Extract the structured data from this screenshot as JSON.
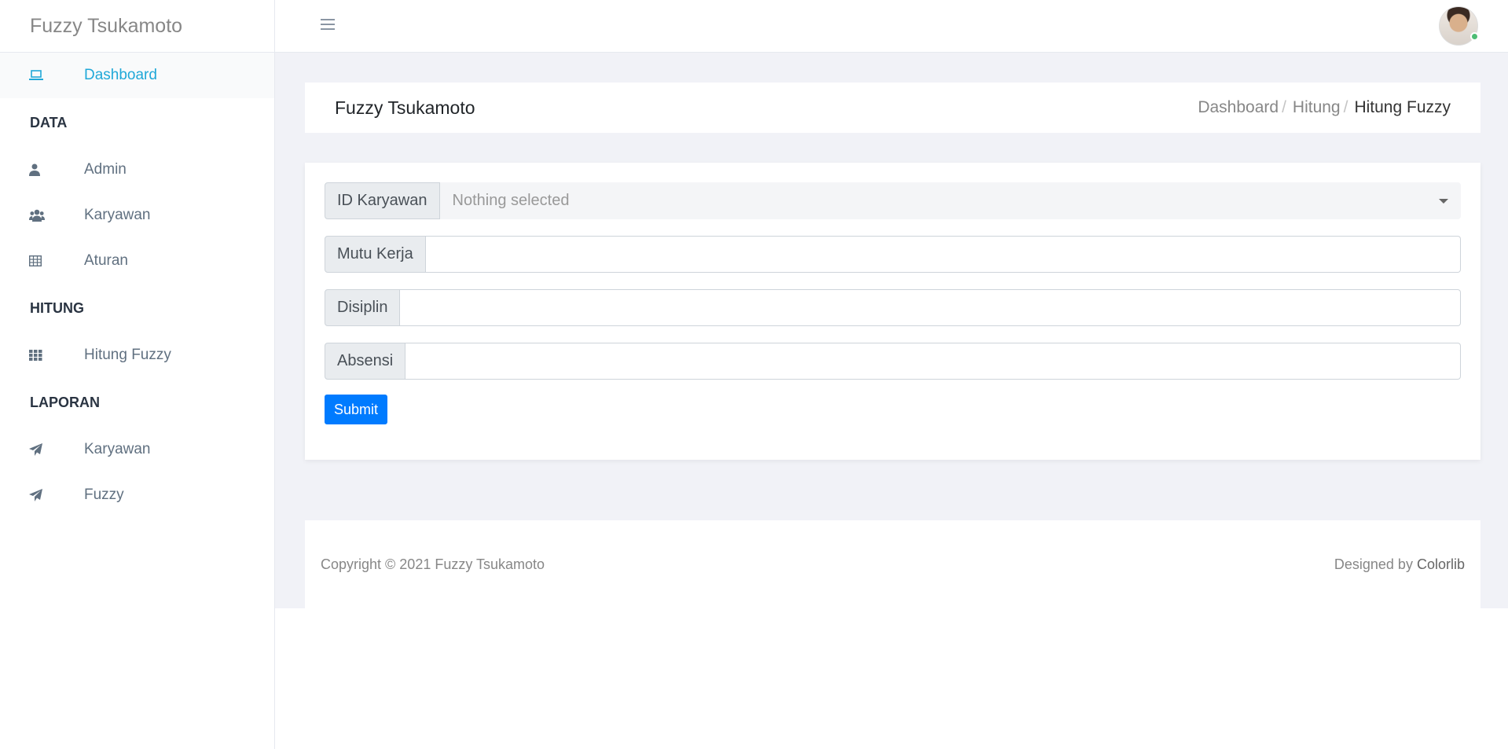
{
  "brand": {
    "title": "Fuzzy Tsukamoto"
  },
  "sidebar": {
    "dashboard": {
      "label": "Dashboard",
      "icon": "laptop-icon"
    },
    "sections": [
      {
        "title": "DATA",
        "items": [
          {
            "label": "Admin",
            "icon": "user-icon"
          },
          {
            "label": "Karyawan",
            "icon": "users-icon"
          },
          {
            "label": "Aturan",
            "icon": "table-icon"
          }
        ]
      },
      {
        "title": "HITUNG",
        "items": [
          {
            "label": "Hitung Fuzzy",
            "icon": "grid-icon"
          }
        ]
      },
      {
        "title": "LAPORAN",
        "items": [
          {
            "label": "Karyawan",
            "icon": "paper-plane-icon"
          },
          {
            "label": "Fuzzy",
            "icon": "paper-plane-icon"
          }
        ]
      }
    ]
  },
  "header": {
    "menu_icon": "hamburger-icon",
    "avatar_status": "online"
  },
  "page": {
    "title": "Fuzzy Tsukamoto",
    "breadcrumb": [
      "Dashboard",
      "Hitung",
      "Hitung Fuzzy"
    ],
    "breadcrumb_separator": "/"
  },
  "form": {
    "id_label": "ID Karyawan",
    "id_value": "Nothing selected",
    "mutu_label": "Mutu Kerja",
    "mutu_value": "",
    "disiplin_label": "Disiplin",
    "disiplin_value": "",
    "absensi_label": "Absensi",
    "absensi_value": "",
    "submit_label": "Submit"
  },
  "footer": {
    "copyright": "Copyright © 2021 Fuzzy Tsukamoto",
    "designed_by": "Designed by",
    "designer": "Colorlib"
  },
  "colors": {
    "accent": "#20a8d8",
    "primary_button": "#007bff",
    "content_bg": "#f1f2f7",
    "online": "#4dbd74"
  }
}
